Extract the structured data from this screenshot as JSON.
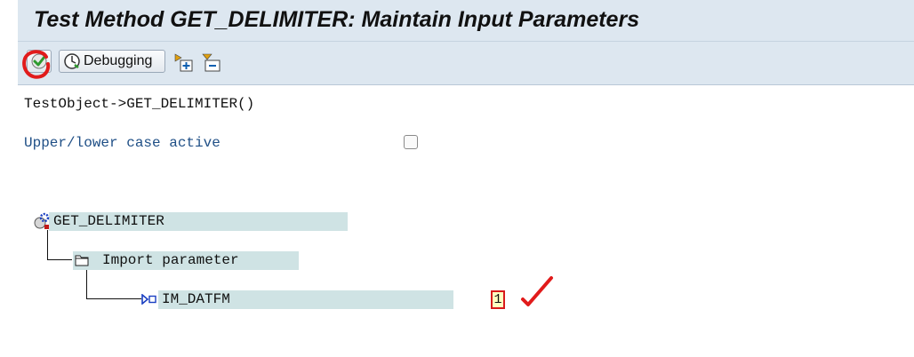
{
  "window": {
    "title": "Test Method GET_DELIMITER: Maintain Input Parameters"
  },
  "toolbar": {
    "execute_icon": "execute-check-icon",
    "debugging_label": "Debugging",
    "expand_icon": "expand-all-icon",
    "collapse_icon": "collapse-all-icon"
  },
  "main": {
    "method_call": "TestObject->GET_DELIMITER()",
    "case_label": "Upper/lower case active",
    "case_checked": false
  },
  "tree": {
    "root": "GET_DELIMITER",
    "folder": "Import parameter",
    "param": "IM_DATFM",
    "param_value": "1"
  },
  "colors": {
    "label_blue": "#1f4f86",
    "highlight": "#cfe3e4",
    "annotation_red": "#e11b1b"
  }
}
